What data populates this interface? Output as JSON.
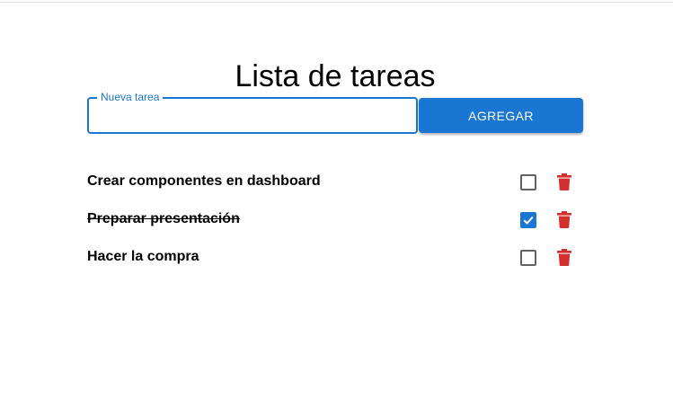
{
  "page": {
    "title": "Lista de tareas"
  },
  "form": {
    "input_label": "Nueva tarea",
    "input_value": "",
    "add_button_label": "Agregar"
  },
  "colors": {
    "primary": "#1976d2",
    "delete": "#d32f2f"
  },
  "tasks": [
    {
      "text": "Crear componentes en dashboard",
      "completed": false,
      "delete_icon": "trash-icon"
    },
    {
      "text": "Preparar presentación",
      "completed": true,
      "delete_icon": "trash-icon"
    },
    {
      "text": "Hacer la compra",
      "completed": false,
      "delete_icon": "trash-icon"
    }
  ]
}
